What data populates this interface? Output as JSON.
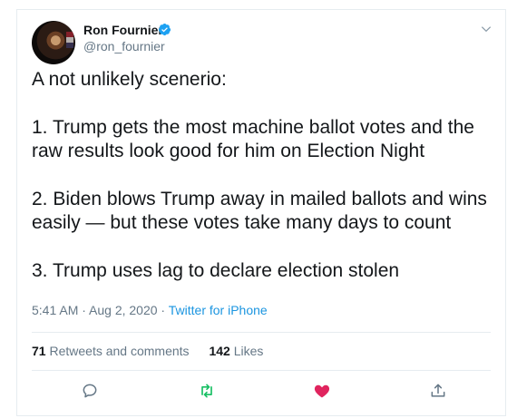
{
  "tweet": {
    "author_name": "Ron Fournier",
    "handle": "@ron_fournier",
    "text_lines": [
      "A not unlikely scenerio:",
      "1. Trump gets the most machine ballot votes and the raw results look good for him on Election Night",
      "2. Biden blows Trump away in mailed ballots and wins easily — but these votes take many days to count",
      "3. Trump uses lag to declare election stolen"
    ],
    "time": "5:41 AM · Aug 2, 2020",
    "separator": " · ",
    "source": "Twitter for iPhone"
  },
  "stats": {
    "retweets_count": "71",
    "retweets_label": "Retweets and comments",
    "likes_count": "142",
    "likes_label": "Likes"
  },
  "icons": {
    "verified": "verified-badge-icon",
    "menu": "chevron-down-icon",
    "reply": "reply-icon",
    "retweet": "retweet-icon",
    "like": "heart-icon",
    "share": "share-icon"
  },
  "colors": {
    "verified": "#1da1f2",
    "retweet_green": "#17bf63",
    "like_red": "#e0245e",
    "link": "#1b95e0",
    "muted": "#657786"
  }
}
